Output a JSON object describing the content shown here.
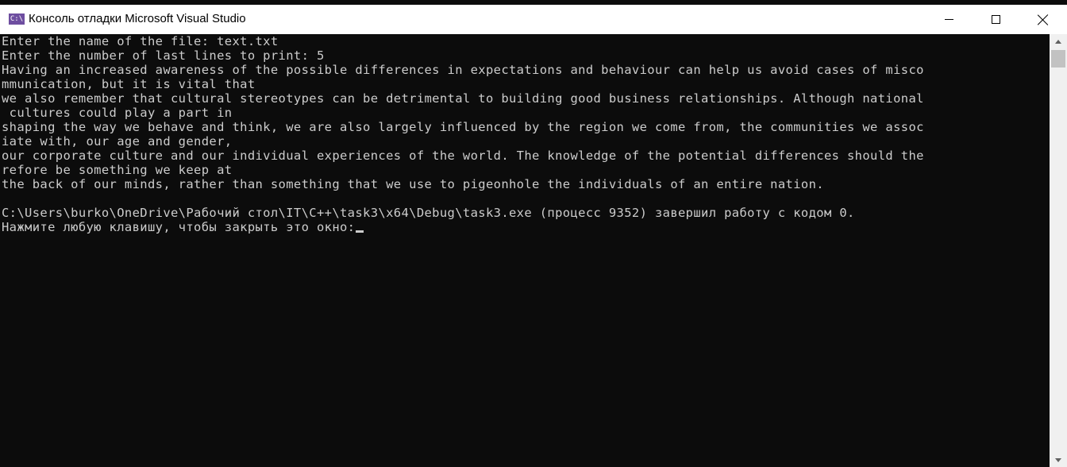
{
  "window": {
    "title": "Консоль отладки Microsoft Visual Studio",
    "icon_text": "C:\\",
    "icon_name": "console-app-icon",
    "controls": {
      "minimize_icon": "minimize-icon",
      "maximize_icon": "maximize-icon",
      "close_icon": "close-icon"
    }
  },
  "console": {
    "background": "#0c0c0c",
    "foreground": "#cccccc",
    "lines": [
      "Enter the name of the file: text.txt",
      "Enter the number of last lines to print: 5",
      "Having an increased awareness of the possible differences in expectations and behaviour can help us avoid cases of misco",
      "mmunication, but it is vital that",
      "we also remember that cultural stereotypes can be detrimental to building good business relationships. Although national",
      " cultures could play a part in",
      "shaping the way we behave and think, we are also largely influenced by the region we come from, the communities we assoc",
      "iate with, our age and gender,",
      "our corporate culture and our individual experiences of the world. The knowledge of the potential differences should the",
      "refore be something we keep at",
      "the back of our minds, rather than something that we use to pigeonhole the individuals of an entire nation.",
      "",
      "C:\\Users\\burko\\OneDrive\\Рабочий стол\\IT\\C++\\task3\\x64\\Debug\\task3.exe (процесс 9352) завершил работу с кодом 0.",
      "Нажмите любую клавишу, чтобы закрыть это окно:"
    ]
  }
}
